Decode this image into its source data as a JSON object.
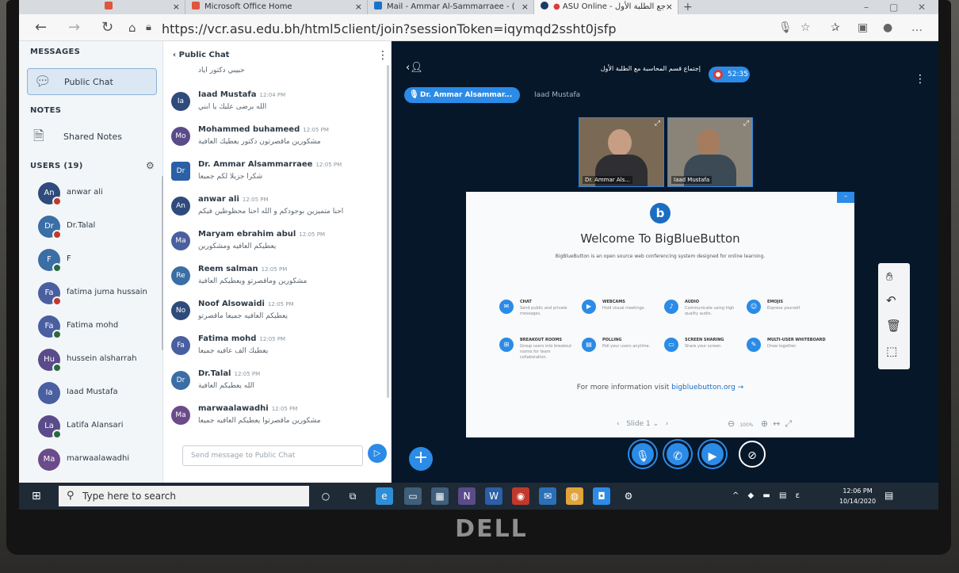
{
  "browser": {
    "tabs": [
      {
        "label": "",
        "close": "×"
      },
      {
        "label": "Microsoft Office Home",
        "close": "×"
      },
      {
        "label": "Mail - Ammar Al-Sammarraee - (",
        "close": "×"
      },
      {
        "label": "ASU Online - ‏ﺟﻊ الطلبة الأول",
        "close": "×"
      }
    ],
    "new_tab": "+",
    "url": "https://vcr.asu.edu.bh/html5client/join?sessionToken=iqymqd2ssht0jsfp"
  },
  "sidebar": {
    "messages_heading": "MESSAGES",
    "public_chat_label": "Public Chat",
    "notes_heading": "NOTES",
    "shared_notes_label": "Shared Notes",
    "users_heading": "USERS (19)",
    "users": [
      {
        "initials": "An",
        "name": "anwar ali",
        "color": "#2f4b7c",
        "badge": "muted"
      },
      {
        "initials": "Dr",
        "name": "Dr.Talal",
        "color": "#3a6ea5",
        "badge": "muted"
      },
      {
        "initials": "F",
        "name": "F",
        "color": "#3a6ea5",
        "badge": "mic"
      },
      {
        "initials": "Fa",
        "name": "fatima juma hussain",
        "color": "#4a5fa0",
        "badge": "muted"
      },
      {
        "initials": "Fa",
        "name": "Fatima mohd",
        "color": "#4a5fa0",
        "badge": "mic"
      },
      {
        "initials": "Hu",
        "name": "hussein alsharrah",
        "color": "#5a4b8a",
        "badge": "mic"
      },
      {
        "initials": "Ia",
        "name": "Iaad Mustafa",
        "color": "#4a5fa0",
        "badge": ""
      },
      {
        "initials": "La",
        "name": "Latifa Alansari",
        "color": "#5a4b8a",
        "badge": "mic"
      },
      {
        "initials": "Ma",
        "name": "marwaalawadhi",
        "color": "#6b4b8a",
        "badge": ""
      }
    ]
  },
  "chat": {
    "header_label": "Public Chat",
    "back_icon": "‹",
    "menu_icon": "⋮",
    "top_partial": "حبيبي دكتور اياد",
    "messages": [
      {
        "initials": "Ia",
        "name": "Iaad Mustafa",
        "time": "12:04 PM",
        "text": "الله يرضى عليك يا ابني",
        "color": "#2f4b7c",
        "square": false
      },
      {
        "initials": "Mo",
        "name": "Mohammed buhameed",
        "time": "12:05 PM",
        "text": "مشكورين ماقصرتون دكتور يعطيك العافية",
        "color": "#5a4b8a",
        "square": false
      },
      {
        "initials": "Dr",
        "name": "Dr. Ammar Alsammarraee",
        "time": "12:05 PM",
        "text": "شكرا جزيلا لكم جميعا",
        "color": "#2b5fa6",
        "square": true
      },
      {
        "initials": "An",
        "name": "anwar ali",
        "time": "12:05 PM",
        "text": "احنا متميزين بوجودكم و الله احنا محظوظين فيكم",
        "color": "#2f4b7c",
        "square": false
      },
      {
        "initials": "Ma",
        "name": "Maryam ebrahim abul",
        "time": "12:05 PM",
        "text": "يعطيكم العافيه ومشكورين",
        "color": "#4a5fa0",
        "square": false
      },
      {
        "initials": "Re",
        "name": "Reem salman",
        "time": "12:05 PM",
        "text": "مشكورين وماقصرتو ويعطيكم العافية",
        "color": "#3a6ea5",
        "square": false
      },
      {
        "initials": "No",
        "name": "Noof Alsowaidi",
        "time": "12:05 PM",
        "text": "يعطيكم العافيه جميعا ماقصرتو",
        "color": "#2f4b7c",
        "square": false
      },
      {
        "initials": "Fa",
        "name": "Fatima mohd",
        "time": "12:05 PM",
        "text": "يعطيك الف عافيه جميعا",
        "color": "#4a5fa0",
        "square": false
      },
      {
        "initials": "Dr",
        "name": "Dr.Talal",
        "time": "12:05 PM",
        "text": "الله يعطيكم العافية",
        "color": "#3a6ea5",
        "square": false
      },
      {
        "initials": "Ma",
        "name": "marwaalawadhi",
        "time": "12:05 PM",
        "text": "مشكورين ماقصرتوا يعطيكم العافيه جميعا",
        "color": "#6b4b8a",
        "square": false
      }
    ],
    "input_placeholder": "Send message to Public Chat",
    "send_icon": "▷"
  },
  "media": {
    "meeting_title": "إجتماع قسم المحاسبة مع الطلبة الأول",
    "recording_time": "52:35",
    "talkers": [
      "Dr. Ammar Alsammar...",
      "Iaad Mustafa"
    ],
    "webcams": [
      {
        "name": "Dr. Ammar Als..."
      },
      {
        "name": "Iaad Mustafa"
      }
    ],
    "slide": {
      "logo_letter": "b",
      "title": "Welcome To BigBlueButton",
      "subtitle": "BigBlueButton is an open source web conferencing system designed for online learning.",
      "features": [
        {
          "title": "CHAT",
          "desc": "Send public and private messages."
        },
        {
          "title": "WEBCAMS",
          "desc": "Hold visual meetings."
        },
        {
          "title": "AUDIO",
          "desc": "Communicate using high quality audio."
        },
        {
          "title": "EMOJIS",
          "desc": "Express yourself."
        },
        {
          "title": "BREAKOUT ROOMS",
          "desc": "Group users into breakout rooms for team collaboration."
        },
        {
          "title": "POLLING",
          "desc": "Poll your users anytime."
        },
        {
          "title": "SCREEN SHARING",
          "desc": "Share your screen."
        },
        {
          "title": "MULTI-USER WHITEBOARD",
          "desc": "Draw together."
        }
      ],
      "more_info_prefix": "For more information visit",
      "more_info_link": "bigbluebutton.org →",
      "slide_selector": "Slide 1",
      "zoom": "100%"
    }
  },
  "taskbar": {
    "search_placeholder": "Type here to search",
    "time": "12:06 PM",
    "date": "10/14/2020"
  },
  "colors": {
    "accent": "#2b8be6",
    "media_bg": "#06172a",
    "taskbar_bg": "#1e2a36"
  }
}
